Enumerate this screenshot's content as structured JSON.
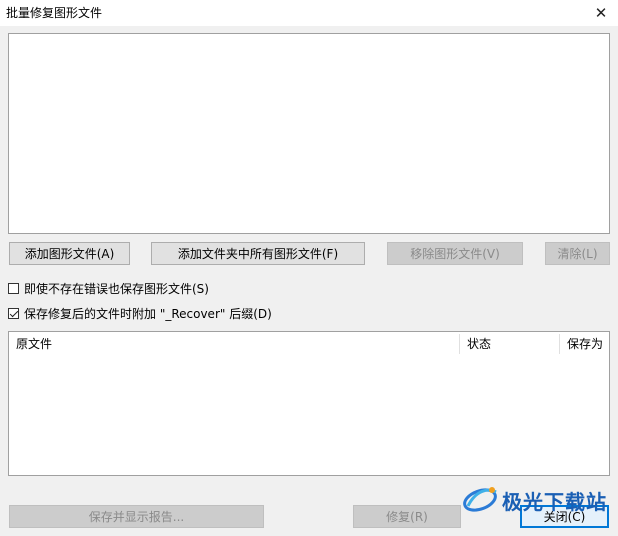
{
  "window": {
    "title": "批量修复图形文件"
  },
  "buttons": {
    "add_files": "添加图形文件(A)",
    "add_folder": "添加文件夹中所有图形文件(F)",
    "remove": "移除图形文件(V)",
    "clear": "清除(L)",
    "save_report": "保存并显示报告...",
    "repair": "修复(R)",
    "close": "关闭(C)"
  },
  "options": {
    "save_even_if_no_errors": {
      "label": "即使不存在错误也保存图形文件(S)",
      "checked": false
    },
    "append_suffix": {
      "label": "保存修复后的文件时附加 \"_Recover\" 后缀(D)",
      "checked": true
    }
  },
  "results_table": {
    "columns": [
      "原文件",
      "状态",
      "保存为"
    ],
    "rows": []
  },
  "watermark": {
    "text": "极光下载站"
  }
}
